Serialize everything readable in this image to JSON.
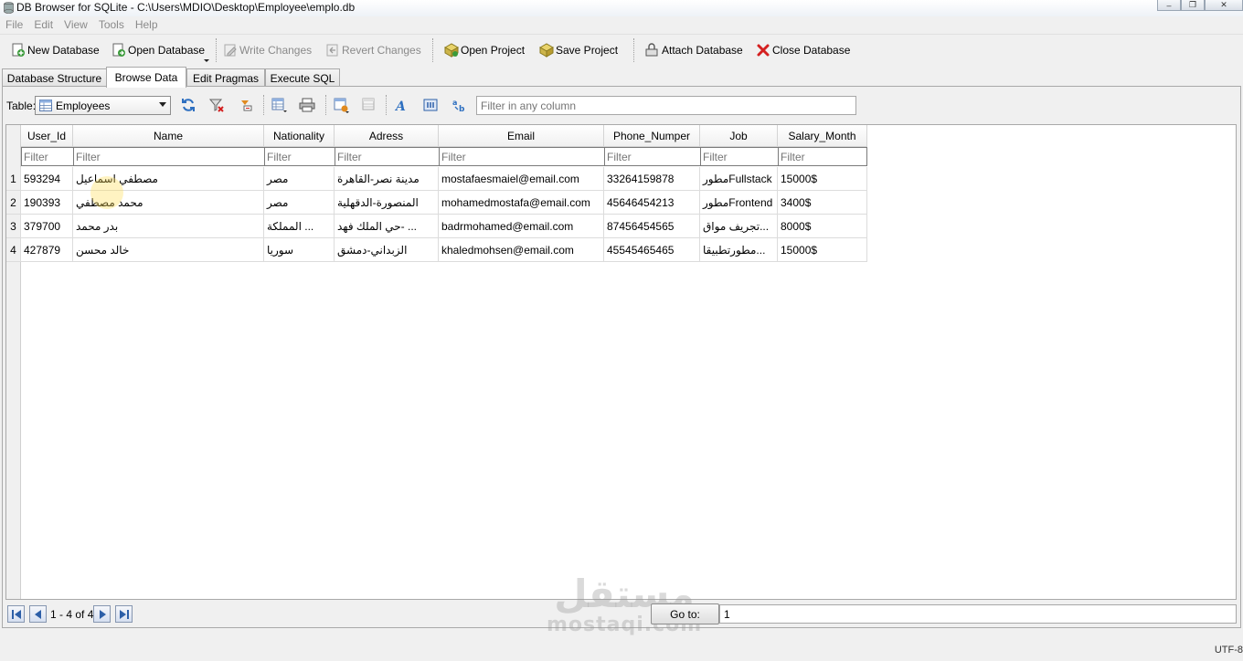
{
  "window": {
    "title": "DB Browser for SQLite - C:\\Users\\MDIO\\Desktop\\Employee\\emplo.db",
    "minimize_glyph": "–",
    "maximize_glyph": "❐",
    "close_glyph": "✕"
  },
  "menu": [
    "File",
    "Edit",
    "View",
    "Tools",
    "Help"
  ],
  "toolbar": {
    "new_database": "New Database",
    "open_database": "Open Database",
    "write_changes": "Write Changes",
    "revert_changes": "Revert Changes",
    "open_project": "Open Project",
    "save_project": "Save Project",
    "attach_database": "Attach Database",
    "close_database": "Close Database"
  },
  "tabs": [
    "Database Structure",
    "Browse Data",
    "Edit Pragmas",
    "Execute SQL"
  ],
  "active_tab": "Browse Data",
  "browse": {
    "table_label": "Table:",
    "table_selected": "Employees",
    "filter_all_placeholder": "Filter in any column",
    "filter_placeholder": "Filter",
    "columns": [
      "User_Id",
      "Name",
      "Nationality",
      "Adress",
      "Email",
      "Phone_Numper",
      "Job",
      "Salary_Month"
    ],
    "rows": [
      {
        "num": "1",
        "cells": [
          "593294",
          "مصطفي اسماعيل",
          "مصر",
          "مدينة نصر-القاهرة",
          "mostafaesmaiel@email.com",
          "33264159878",
          "مطورFullstack",
          "15000$"
        ]
      },
      {
        "num": "2",
        "cells": [
          "190393",
          "محمد مصطفي",
          "مصر",
          "المنصورة-الدقهلية",
          "mohamedmostafa@email.com",
          "45646454213",
          "مطورFrontend",
          "3400$"
        ]
      },
      {
        "num": "3",
        "cells": [
          "379700",
          "بدر محمد",
          "المملكة ...",
          "حي الملك فهد- ...",
          "badrmohamed@email.com",
          "87456454565",
          "تجريف مواق...",
          "8000$"
        ]
      },
      {
        "num": "4",
        "cells": [
          "427879",
          "خالد محسن",
          "سوريا",
          "الزبداني-دمشق",
          "khaledmohsen@email.com",
          "45545465465",
          "مطورتطبيقا...",
          "15000$"
        ]
      }
    ]
  },
  "navigation": {
    "record_info": "1 - 4 of 4",
    "goto_label": "Go to:",
    "goto_value": "1"
  },
  "watermark": {
    "arabic": "مستقل",
    "latin": "mostaqi.com"
  },
  "status": {
    "encoding": "UTF-8"
  },
  "colors": {
    "accent_green": "#3a9a3a",
    "close_red": "#d42020",
    "nav_blue": "#2d5fa8"
  }
}
